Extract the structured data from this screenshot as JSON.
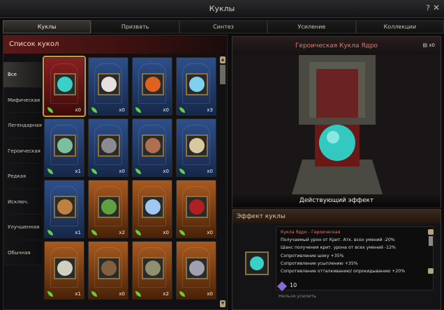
{
  "window": {
    "title": "Куклы",
    "help": "?",
    "close": "✕"
  },
  "tabs": [
    {
      "label": "Куклы"
    },
    {
      "label": "Призвать"
    },
    {
      "label": "Синтез"
    },
    {
      "label": "Усиление"
    },
    {
      "label": "Коллекции"
    }
  ],
  "left": {
    "title": "Список кукол",
    "categories": [
      "Все",
      "Мифическая",
      "Легендарная",
      "Героическая",
      "Редкая",
      "Исключ.",
      "Улучшенная",
      "Обычная"
    ],
    "cards": [
      {
        "frame": "red",
        "portrait": "#3ad0c8",
        "count": "x0"
      },
      {
        "frame": "blue",
        "portrait": "#e8e0e0",
        "count": "x0"
      },
      {
        "frame": "blue",
        "portrait": "#e06020",
        "count": "x0"
      },
      {
        "frame": "blue",
        "portrait": "#80d0f0",
        "count": "x3"
      },
      {
        "frame": "blue",
        "portrait": "#7ac0a0",
        "count": "x1"
      },
      {
        "frame": "blue",
        "portrait": "#8a8a90",
        "count": "x0"
      },
      {
        "frame": "blue",
        "portrait": "#b07050",
        "count": "x0"
      },
      {
        "frame": "blue",
        "portrait": "#d8c8a0",
        "count": "x0"
      },
      {
        "frame": "blue",
        "portrait": "#c08040",
        "count": "x1"
      },
      {
        "frame": "orange",
        "portrait": "#60a040",
        "count": "x2"
      },
      {
        "frame": "orange",
        "portrait": "#a0c8f0",
        "count": "x0"
      },
      {
        "frame": "orange",
        "portrait": "#b02020",
        "count": "x0"
      },
      {
        "frame": "orange",
        "portrait": "#d0d0c0",
        "count": "x1"
      },
      {
        "frame": "orange",
        "portrait": "#806040",
        "count": "x0"
      },
      {
        "frame": "orange",
        "portrait": "#909070",
        "count": "x2"
      },
      {
        "frame": "orange",
        "portrait": "#a0a0b0",
        "count": "x0"
      }
    ]
  },
  "right": {
    "title": "Героическая Кукла Ядро",
    "stack": "x0",
    "effect_label": "Действующий эффект"
  },
  "effect": {
    "title": "Эффект куклы",
    "name": "Кукла Ядро - Героическая",
    "lines": [
      "Получаемый урон от Крит. Атк. всех умений -20%",
      "Шанс получения крит. урона от всех умений -12%",
      "Сопротивление шоку +35%",
      "Сопротивление усыплению +35%",
      "Сопротивление отталкиванию/ опрокидыванию +20%"
    ],
    "level": "10",
    "enhance": "Нельзя усилить"
  }
}
